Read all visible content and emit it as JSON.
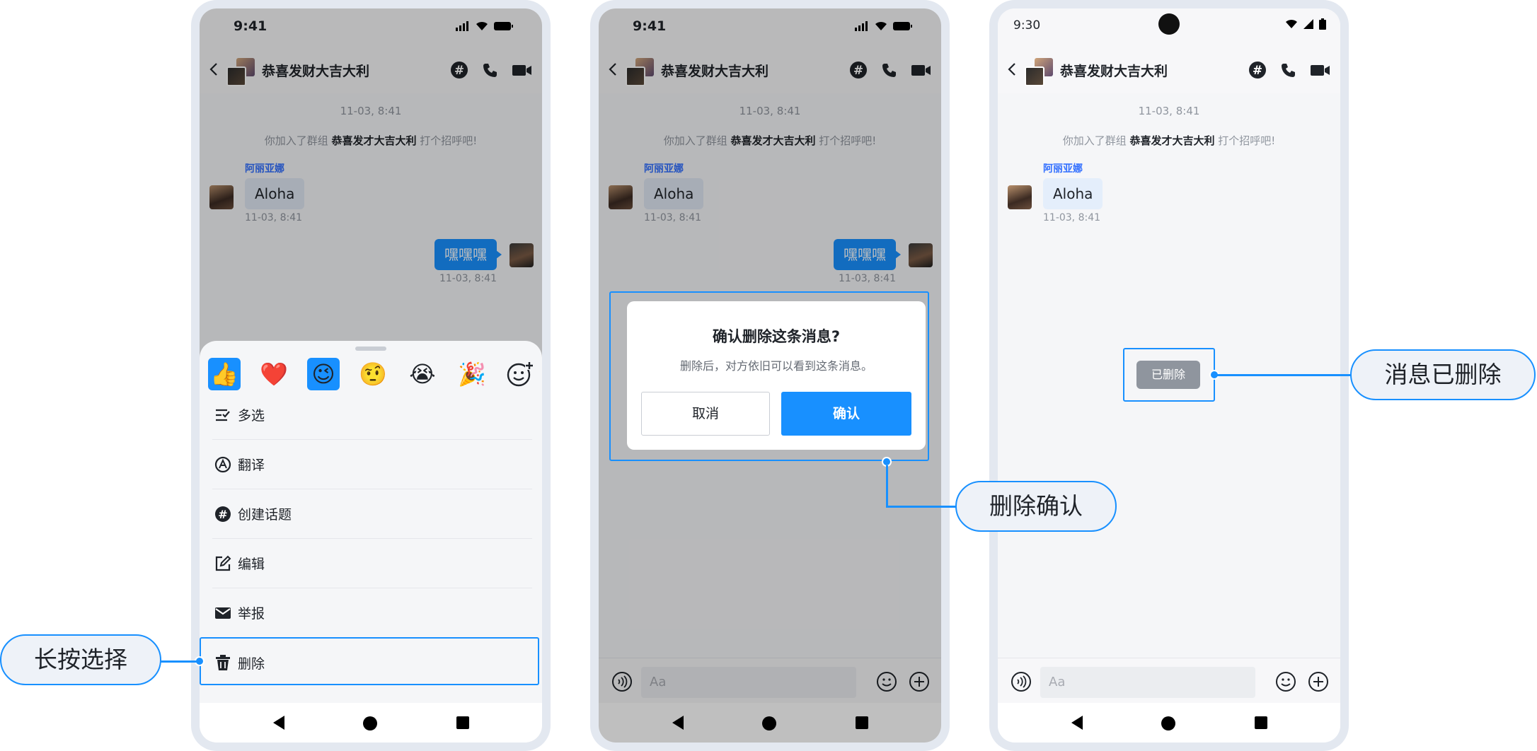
{
  "colors": {
    "accent": "#1890ff",
    "frame": "#e3e8f0",
    "deleted_chip": "#8f959e"
  },
  "chat": {
    "title": "恭喜发财大吉大利",
    "timestamp": "11-03, 8:41",
    "system_prefix": "你加入了群组",
    "system_group": "恭喜发才大吉大利",
    "system_suffix": "打个招呼吧!",
    "sender_name": "阿丽亚娜",
    "incoming_text": "Aloha",
    "incoming_time": "11-03, 8:41",
    "outgoing_text": "嘿嘿嘿",
    "outgoing_time": "11-03, 8:41",
    "input_placeholder": "Aa"
  },
  "phones": {
    "ios_time": "9:41",
    "android_time": "9:30"
  },
  "sheet": {
    "emojis": [
      {
        "name": "thumbs-up",
        "glyph": "👍",
        "selected": true
      },
      {
        "name": "heart",
        "glyph": "❤️",
        "selected": false
      },
      {
        "name": "wink",
        "glyph": "😉",
        "selected": true
      },
      {
        "name": "raised-eyebrow",
        "glyph": "🤨",
        "selected": false
      },
      {
        "name": "crying",
        "glyph": "😭",
        "selected": false
      },
      {
        "name": "party",
        "glyph": "🎉",
        "selected": false
      }
    ],
    "items": [
      {
        "label": "多选",
        "icon": "multi-select-icon"
      },
      {
        "label": "翻译",
        "icon": "translate-icon"
      },
      {
        "label": "创建话题",
        "icon": "topic-icon"
      },
      {
        "label": "编辑",
        "icon": "edit-icon"
      },
      {
        "label": "举报",
        "icon": "report-icon"
      },
      {
        "label": "删除",
        "icon": "trash-icon"
      }
    ]
  },
  "dialog": {
    "title": "确认删除这条消息?",
    "message": "删除后，对方依旧可以看到这条消息。",
    "cancel": "取消",
    "confirm": "确认"
  },
  "deleted_label": "已删除",
  "callouts": {
    "long_press": "长按选择",
    "delete_confirm": "删除确认",
    "deleted": "消息已删除"
  }
}
